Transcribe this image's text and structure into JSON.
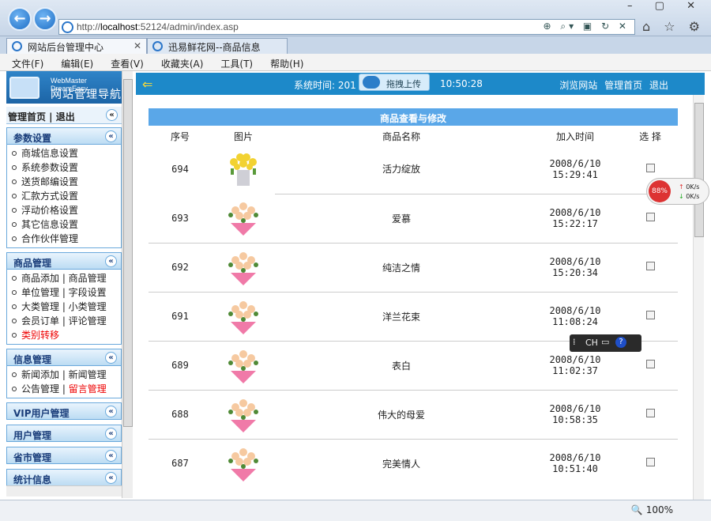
{
  "browser": {
    "url_prefix": "http://",
    "url_host": "localhost",
    "url_rest": ":52124/admin/index.asp",
    "tabs": [
      {
        "label": "网站后台管理中心",
        "active": true
      },
      {
        "label": "迅易鲜花网--商品信息",
        "active": false
      }
    ],
    "menu": [
      "文件(F)",
      "编辑(E)",
      "查看(V)",
      "收藏夹(A)",
      "工具(T)",
      "帮助(H)"
    ],
    "zoom": "100%"
  },
  "sidebar": {
    "brand_small": "WebMaster DreamEasy",
    "brand_title": "网站管理导航",
    "home_links": "管理首页 | 退出",
    "sections": [
      {
        "title": "参数设置",
        "items": [
          {
            "label": "商城信息设置"
          },
          {
            "label": "系统参数设置"
          },
          {
            "label": "送货邮编设置"
          },
          {
            "label": "汇款方式设置"
          },
          {
            "label": "浮动价格设置"
          },
          {
            "label": "其它信息设置"
          },
          {
            "label": "合作伙伴管理"
          }
        ]
      },
      {
        "title": "商品管理",
        "items": [
          {
            "label": "商品添加 | 商品管理"
          },
          {
            "label": "单位管理 | 字段设置"
          },
          {
            "label": "大类管理 | 小类管理"
          },
          {
            "label": "会员订单 | 评论管理"
          },
          {
            "label": "类别转移",
            "red": true
          }
        ]
      },
      {
        "title": "信息管理",
        "items": [
          {
            "label": "新闻添加 | 新闻管理"
          },
          {
            "label": "公告管理 | ",
            "red_suffix": "留言管理"
          }
        ]
      },
      {
        "title": "VIP用户管理",
        "items": []
      },
      {
        "title": "用户管理",
        "items": []
      },
      {
        "title": "省市管理",
        "items": []
      },
      {
        "title": "统计信息",
        "items": []
      }
    ]
  },
  "header": {
    "sys_time_label": "系统时间: 201",
    "drag_upload": "拖拽上传",
    "time": "10:50:28",
    "links": [
      "浏览网站",
      "管理首页",
      "退出"
    ]
  },
  "content": {
    "title": "商品查看与修改",
    "columns": [
      "序号",
      "图片",
      "商品名称",
      "加入时间",
      "选 择"
    ],
    "rows": [
      {
        "id": "694",
        "name": "活力绽放",
        "time": "2008/6/10 15:29:41",
        "img": "yellow-tulip-bouquet"
      },
      {
        "id": "693",
        "name": "爱慕",
        "time": "2008/6/10 15:22:17",
        "img": "pink-rose-bouquet"
      },
      {
        "id": "692",
        "name": "纯洁之情",
        "time": "2008/6/10 15:20:34",
        "img": "pink-rose-bouquet"
      },
      {
        "id": "691",
        "name": "洋兰花束",
        "time": "2008/6/10 11:08:24",
        "img": "pink-rose-bouquet"
      },
      {
        "id": "689",
        "name": "表白",
        "time": "2008/6/10 11:02:37",
        "img": "pink-rose-bouquet"
      },
      {
        "id": "688",
        "name": "伟大的母爱",
        "time": "2008/6/10 10:58:35",
        "img": "pink-rose-bouquet"
      },
      {
        "id": "687",
        "name": "完美情人",
        "time": "2008/6/10 10:51:40",
        "img": "pink-rose-bouquet"
      }
    ]
  },
  "overlays": {
    "net_percent": "88%",
    "net_up": "0K/s",
    "net_down": "0K/s",
    "ime": "CH"
  }
}
